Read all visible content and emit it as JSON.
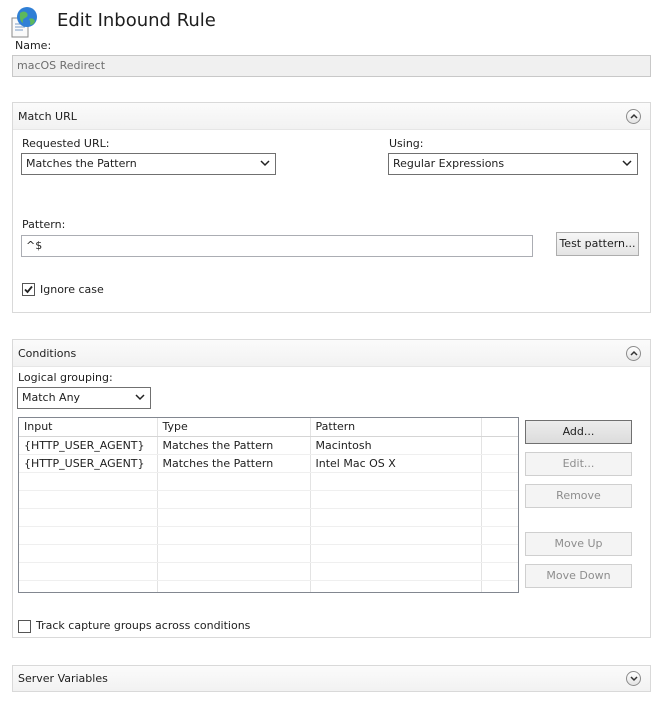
{
  "header": {
    "title": "Edit Inbound Rule"
  },
  "name_field": {
    "label": "Name:",
    "value": "macOS Redirect"
  },
  "match_url": {
    "title": "Match URL",
    "requested_url_label": "Requested URL:",
    "requested_url_value": "Matches the Pattern",
    "using_label": "Using:",
    "using_value": "Regular Expressions",
    "pattern_label": "Pattern:",
    "pattern_value": "^$",
    "test_pattern_button": "Test pattern...",
    "ignore_case_label": "Ignore case",
    "ignore_case_checked": true
  },
  "conditions": {
    "title": "Conditions",
    "logical_grouping_label": "Logical grouping:",
    "logical_grouping_value": "Match Any",
    "columns": [
      "Input",
      "Type",
      "Pattern"
    ],
    "rows": [
      [
        "{HTTP_USER_AGENT}",
        "Matches the Pattern",
        "Macintosh"
      ],
      [
        "{HTTP_USER_AGENT}",
        "Matches the Pattern",
        "Intel Mac OS X"
      ]
    ],
    "buttons": {
      "add": "Add...",
      "edit": "Edit...",
      "remove": "Remove",
      "move_up": "Move Up",
      "move_down": "Move Down"
    },
    "track_capture_label": "Track capture groups across conditions",
    "track_capture_checked": false
  },
  "server_variables": {
    "title": "Server Variables"
  },
  "icons": {
    "rule": "globe-document-icon",
    "collapse": "chevron-up-circle-icon",
    "expand": "chevron-down-circle-icon",
    "dropdown": "chevron-down-icon",
    "check": "checkmark-icon"
  }
}
